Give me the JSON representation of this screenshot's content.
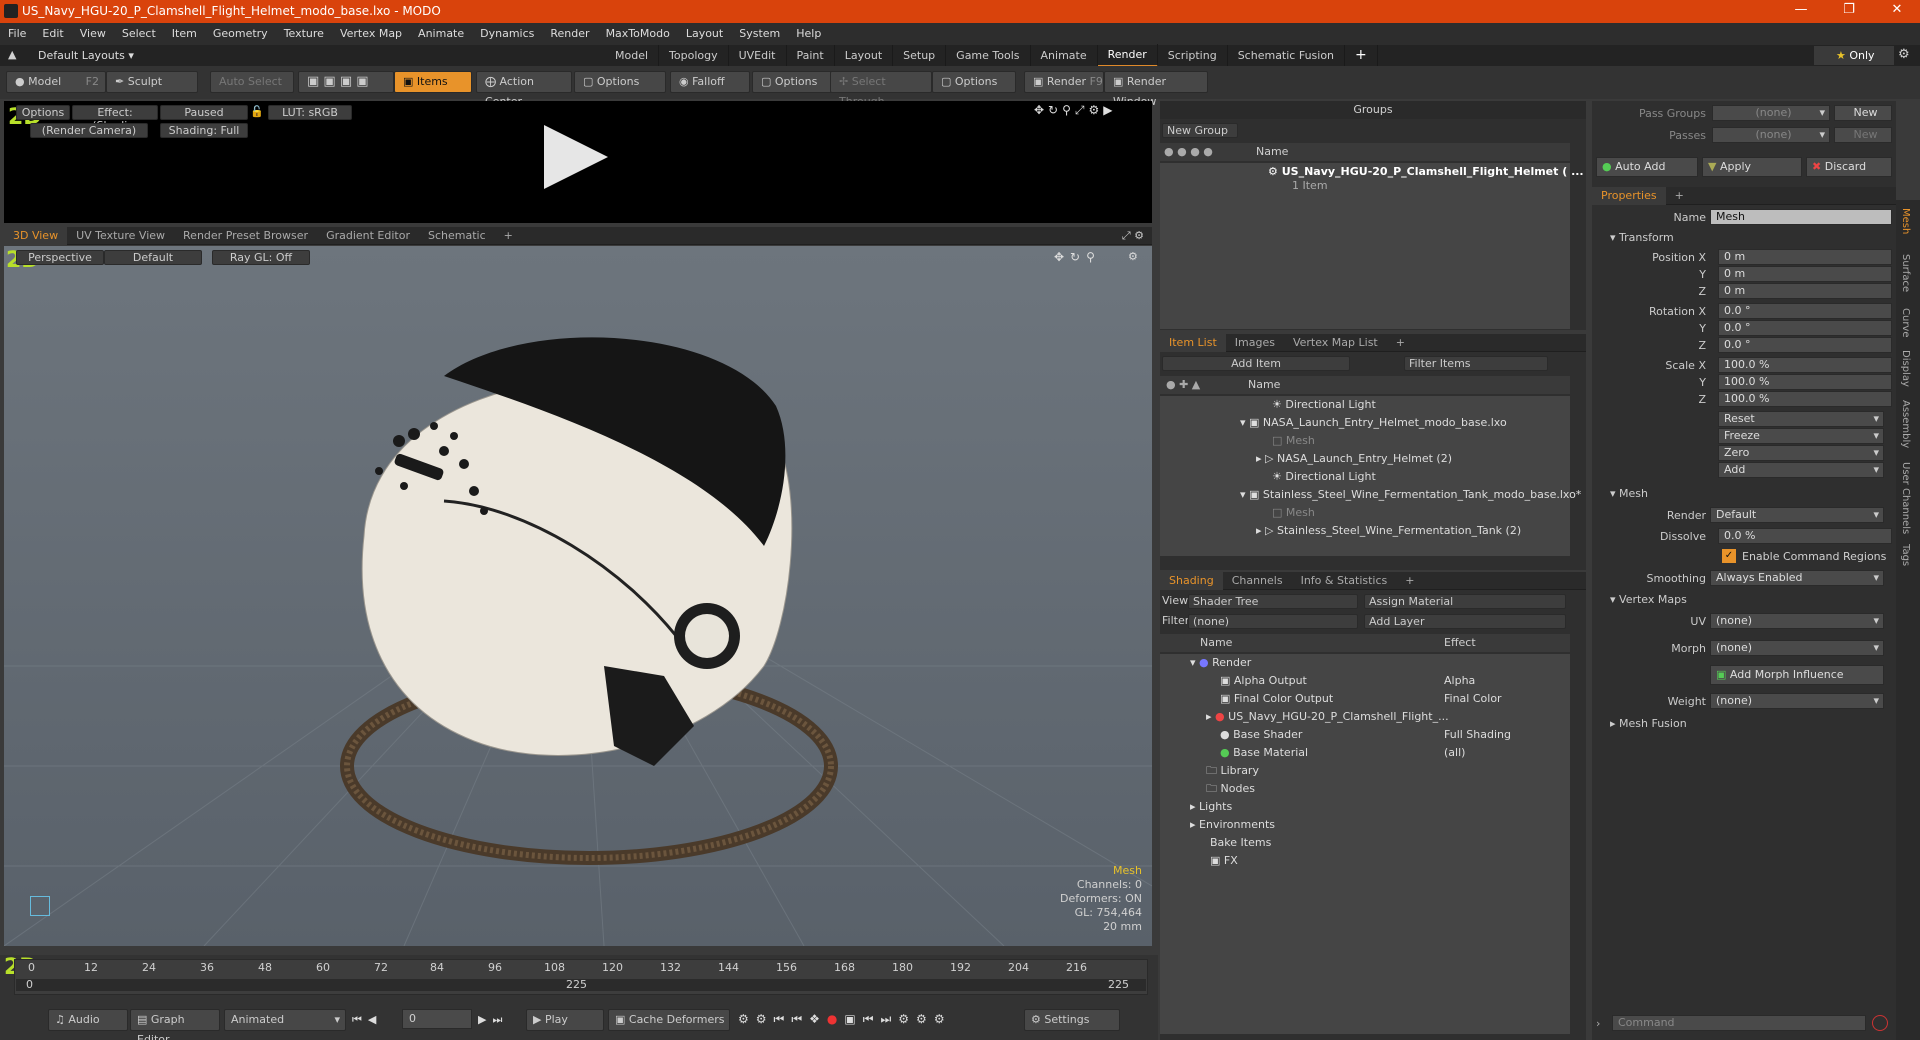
{
  "window": {
    "title": "US_Navy_HGU-20_P_Clamshell_Flight_Helmet_modo_base.lxo - MODO"
  },
  "menu": [
    "File",
    "Edit",
    "View",
    "Select",
    "Item",
    "Geometry",
    "Texture",
    "Vertex Map",
    "Animate",
    "Dynamics",
    "Render",
    "MaxToModo",
    "Layout",
    "System",
    "Help"
  ],
  "layouts": {
    "default": "Default Layouts",
    "tabs": [
      "Model",
      "Topology",
      "UVEdit",
      "Paint",
      "Layout",
      "Setup",
      "Game Tools",
      "Animate",
      "Render",
      "Scripting",
      "Schematic Fusion"
    ],
    "active": "Render",
    "only": "Only"
  },
  "toolbar": {
    "model": "Model",
    "model_key": "F2",
    "sculpt": "Sculpt",
    "auto_select": "Auto Select",
    "items": "Items",
    "action_center": "Action Center",
    "options1": "Options",
    "falloff": "Falloff",
    "options2": "Options",
    "select_through": "Select Through",
    "options3": "Options",
    "render": "Render",
    "render_key": "F9",
    "render_window": "Render Window"
  },
  "render_view": {
    "options": "Options",
    "effect": "Effect: (Shadi...",
    "paused": "Paused",
    "lut": "LUT: sRGB",
    "camera": "(Render Camera)",
    "shading": "Shading: Full"
  },
  "viewport_tabs": [
    "3D View",
    "UV Texture View",
    "Render Preset Browser",
    "Gradient Editor",
    "Schematic"
  ],
  "viewport": {
    "perspective": "Perspective",
    "default": "Default",
    "raygl": "Ray GL: Off",
    "info": {
      "mesh": "Mesh",
      "channels": "Channels: 0",
      "deformers": "Deformers: ON",
      "gl": "GL: 754,464",
      "scale": "20 mm"
    }
  },
  "groups": {
    "title": "Groups",
    "new_group": "New Group",
    "col_name": "Name",
    "item_name": "US_Navy_HGU-20_P_Clamshell_Flight_Helmet ( ...",
    "item_sub": "1 Item"
  },
  "itemlist": {
    "tabs": [
      "Item List",
      "Images",
      "Vertex Map List"
    ],
    "add_item": "Add Item",
    "filter": "Filter Items",
    "col_name": "Name",
    "rows": [
      "Directional Light",
      "NASA_Launch_Entry_Helmet_modo_base.lxo",
      "Mesh",
      "NASA_Launch_Entry_Helmet (2)",
      "Directional Light",
      "Stainless_Steel_Wine_Fermentation_Tank_modo_base.lxo*",
      "Mesh",
      "Stainless_Steel_Wine_Fermentation_Tank (2)"
    ]
  },
  "shading": {
    "tabs": [
      "Shading",
      "Channels",
      "Info & Statistics"
    ],
    "view_label": "View",
    "view": "Shader Tree",
    "assign": "Assign Material",
    "filter_label": "Filter",
    "filter": "(none)",
    "add_layer": "Add Layer",
    "col_name": "Name",
    "col_effect": "Effect",
    "rows": [
      {
        "name": "Render",
        "effect": ""
      },
      {
        "name": "Alpha Output",
        "effect": "Alpha"
      },
      {
        "name": "Final Color Output",
        "effect": "Final Color"
      },
      {
        "name": "US_Navy_HGU-20_P_Clamshell_Flight_...",
        "effect": ""
      },
      {
        "name": "Base Shader",
        "effect": "Full Shading"
      },
      {
        "name": "Base Material",
        "effect": "(all)"
      },
      {
        "name": "Library",
        "effect": ""
      },
      {
        "name": "Nodes",
        "effect": ""
      },
      {
        "name": "Lights",
        "effect": ""
      },
      {
        "name": "Environments",
        "effect": ""
      },
      {
        "name": "Bake Items",
        "effect": ""
      },
      {
        "name": "FX",
        "effect": ""
      }
    ]
  },
  "passes": {
    "pass_groups": "Pass Groups",
    "passes": "Passes",
    "none": "(none)",
    "new": "New",
    "auto_add": "Auto Add",
    "apply": "Apply",
    "discard": "Discard"
  },
  "properties": {
    "tab": "Properties",
    "name_label": "Name",
    "name": "Mesh",
    "transform": "Transform",
    "position_label": "Position X",
    "rotation_label": "Rotation X",
    "scale_label": "Scale X",
    "y": "Y",
    "z": "Z",
    "pos": [
      "0 m",
      "0 m",
      "0 m"
    ],
    "rot": [
      "0.0 °",
      "0.0 °",
      "0.0 °"
    ],
    "scale": [
      "100.0 %",
      "100.0 %",
      "100.0 %"
    ],
    "actions": [
      "Reset",
      "Freeze",
      "Zero",
      "Add"
    ],
    "mesh_section": "Mesh",
    "render_label": "Render",
    "render": "Default",
    "dissolve_label": "Dissolve",
    "dissolve": "0.0 %",
    "enable_cmd": "Enable Command Regions",
    "smoothing_label": "Smoothing",
    "smoothing": "Always Enabled",
    "vertex_maps": "Vertex Maps",
    "uv_label": "UV",
    "uv": "(none)",
    "morph_label": "Morph",
    "morph": "(none)",
    "add_morph": "Add Morph Influence",
    "weight_label": "Weight",
    "weight": "(none)",
    "mesh_fusion": "Mesh Fusion"
  },
  "sidetabs": [
    "Mesh",
    "Surface",
    "Curve",
    "Display",
    "Assembly",
    "User Channels",
    "Tags"
  ],
  "timeline": {
    "ticks": [
      "0",
      "12",
      "24",
      "36",
      "48",
      "60",
      "72",
      "84",
      "96",
      "108",
      "120",
      "132",
      "144",
      "156",
      "168",
      "180",
      "192",
      "204",
      "216"
    ],
    "start": "0",
    "end": "225",
    "mid": "225"
  },
  "bottom": {
    "audio": "Audio",
    "graph_editor": "Graph Editor",
    "animated": "Animated",
    "frame": "0",
    "play": "Play",
    "cache": "Cache Deformers",
    "settings": "Settings",
    "command": "Command"
  }
}
